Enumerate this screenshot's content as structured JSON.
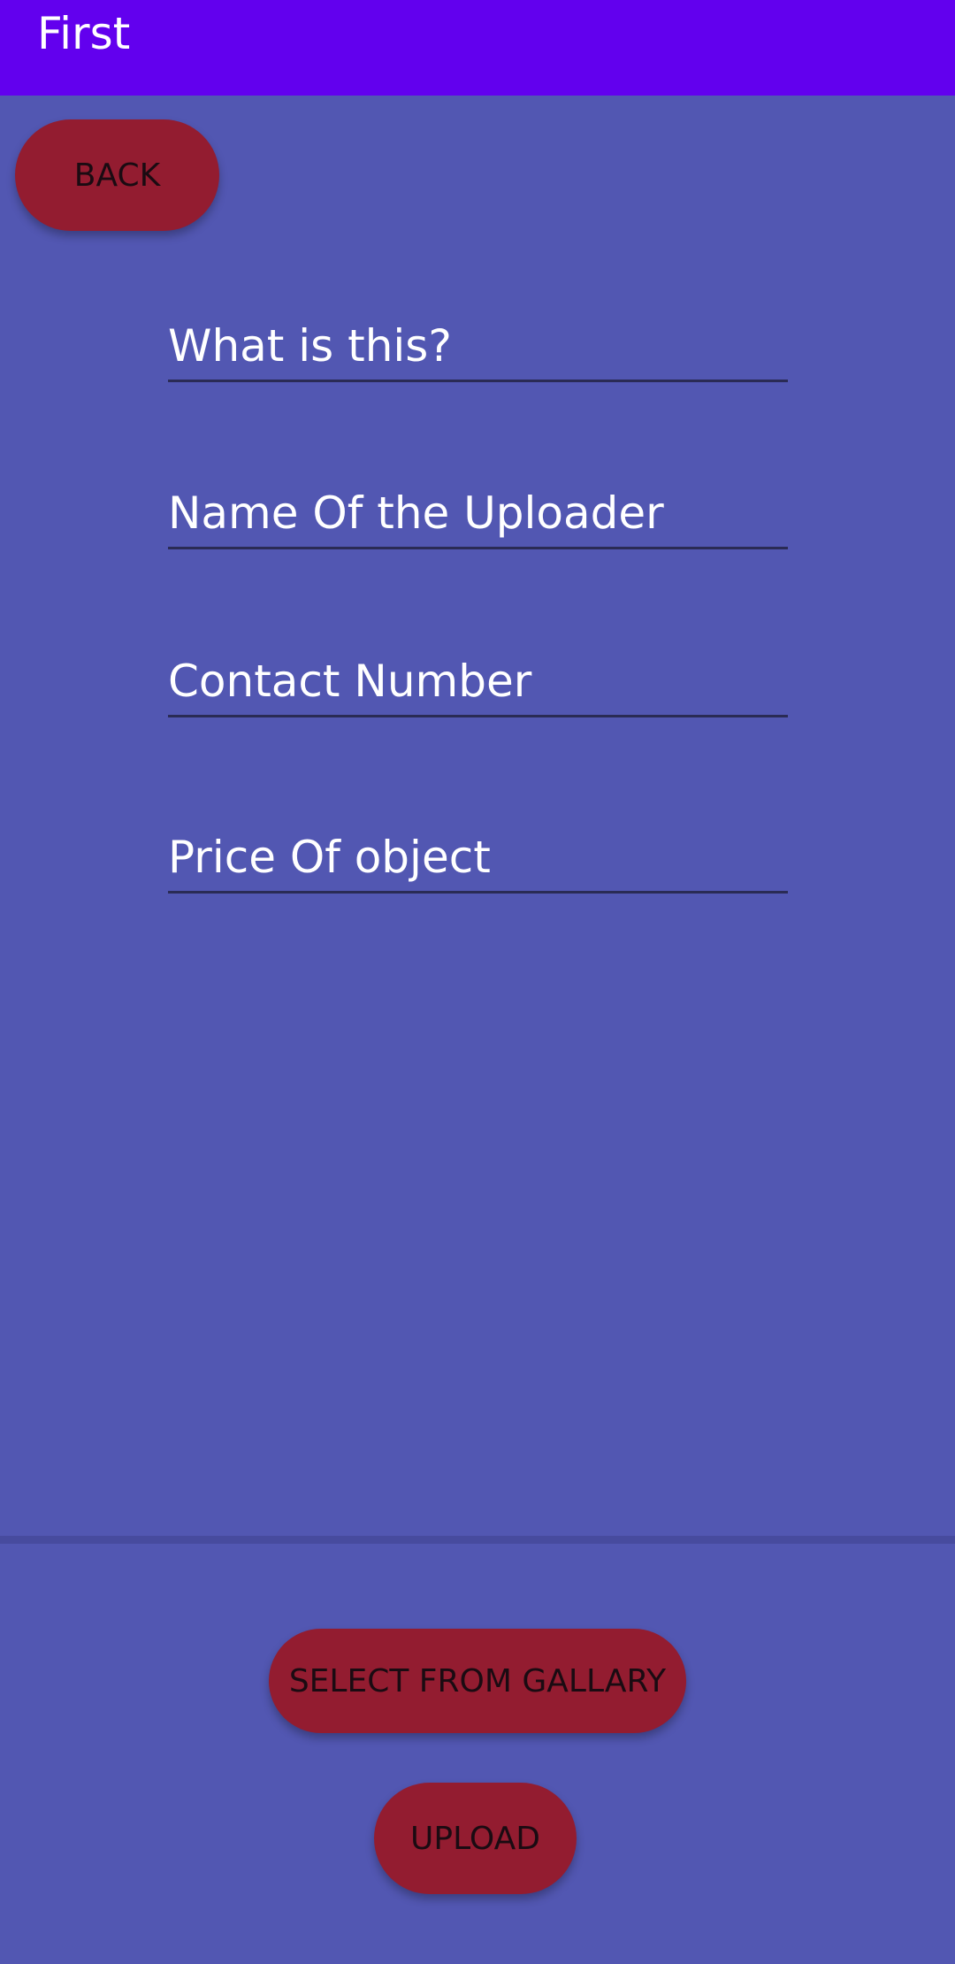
{
  "app_bar": {
    "title": "First",
    "color": "#6200ee"
  },
  "background_color": "#5257b2",
  "buttons": {
    "back_label": "BACK",
    "gallery_label": "SELECT FROM GALLARY",
    "upload_label": "UPLOAD",
    "color": "#931c30"
  },
  "form": {
    "what_placeholder": "What is this?",
    "uploader_placeholder": "Name Of the Uploader",
    "contact_placeholder": "Contact Number",
    "price_placeholder": "Price Of object"
  }
}
